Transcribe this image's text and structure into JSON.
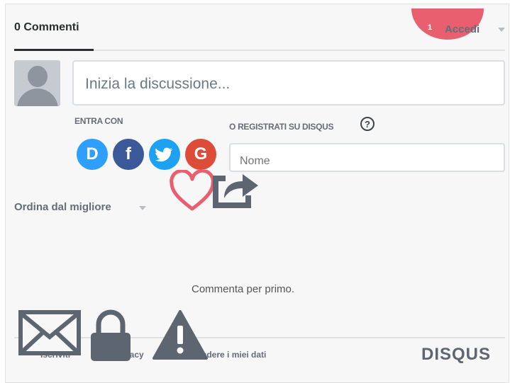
{
  "header": {
    "comment_count_label": "0 Commenti",
    "notification_count": "1",
    "login_label": "Accedi"
  },
  "compose": {
    "placeholder": "Inizia la discussione..."
  },
  "login_options": {
    "enter_with_label": "ENTRA CON",
    "register_label": "O REGISTRATI SU DISQUS",
    "help_glyph": "?",
    "name_placeholder": "Nome",
    "providers": [
      {
        "name": "disqus-icon",
        "glyph": "D",
        "color": "#2e9fff"
      },
      {
        "name": "facebook-icon",
        "glyph": "f",
        "color": "#3b5998"
      },
      {
        "name": "twitter-icon",
        "glyph": "t",
        "color": "#1da1f2"
      },
      {
        "name": "google-icon",
        "glyph": "G",
        "color": "#dd4b39"
      }
    ]
  },
  "sort": {
    "label": "Ordina dal migliore"
  },
  "empty_state": {
    "message": "Commenta per primo."
  },
  "footer": {
    "subscribe_label": "Iscriviti",
    "privacy_label": "Privacy",
    "do_not_sell_label": "Non vendere i miei dati",
    "brand": "DISQUS"
  },
  "colors": {
    "accent_badge": "#e8606f",
    "overlay_icon": "#5d6670",
    "heart": "#e8606f"
  }
}
